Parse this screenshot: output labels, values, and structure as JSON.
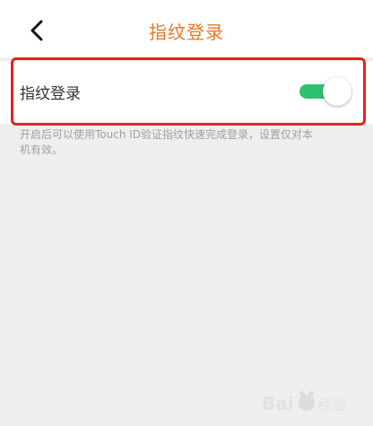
{
  "header": {
    "title": "指纹登录",
    "back_icon": "chevron-left-icon"
  },
  "setting": {
    "label": "指纹登录",
    "toggle_on": true,
    "toggle_color": "#2ec270"
  },
  "description": "开启后可以使用Touch ID验证指纹快速完成登录，设置仅对本机有效。",
  "colors": {
    "title": "#e8762a",
    "highlight_border": "#e8211b"
  },
  "watermark": {
    "text": "Baidu经验"
  }
}
